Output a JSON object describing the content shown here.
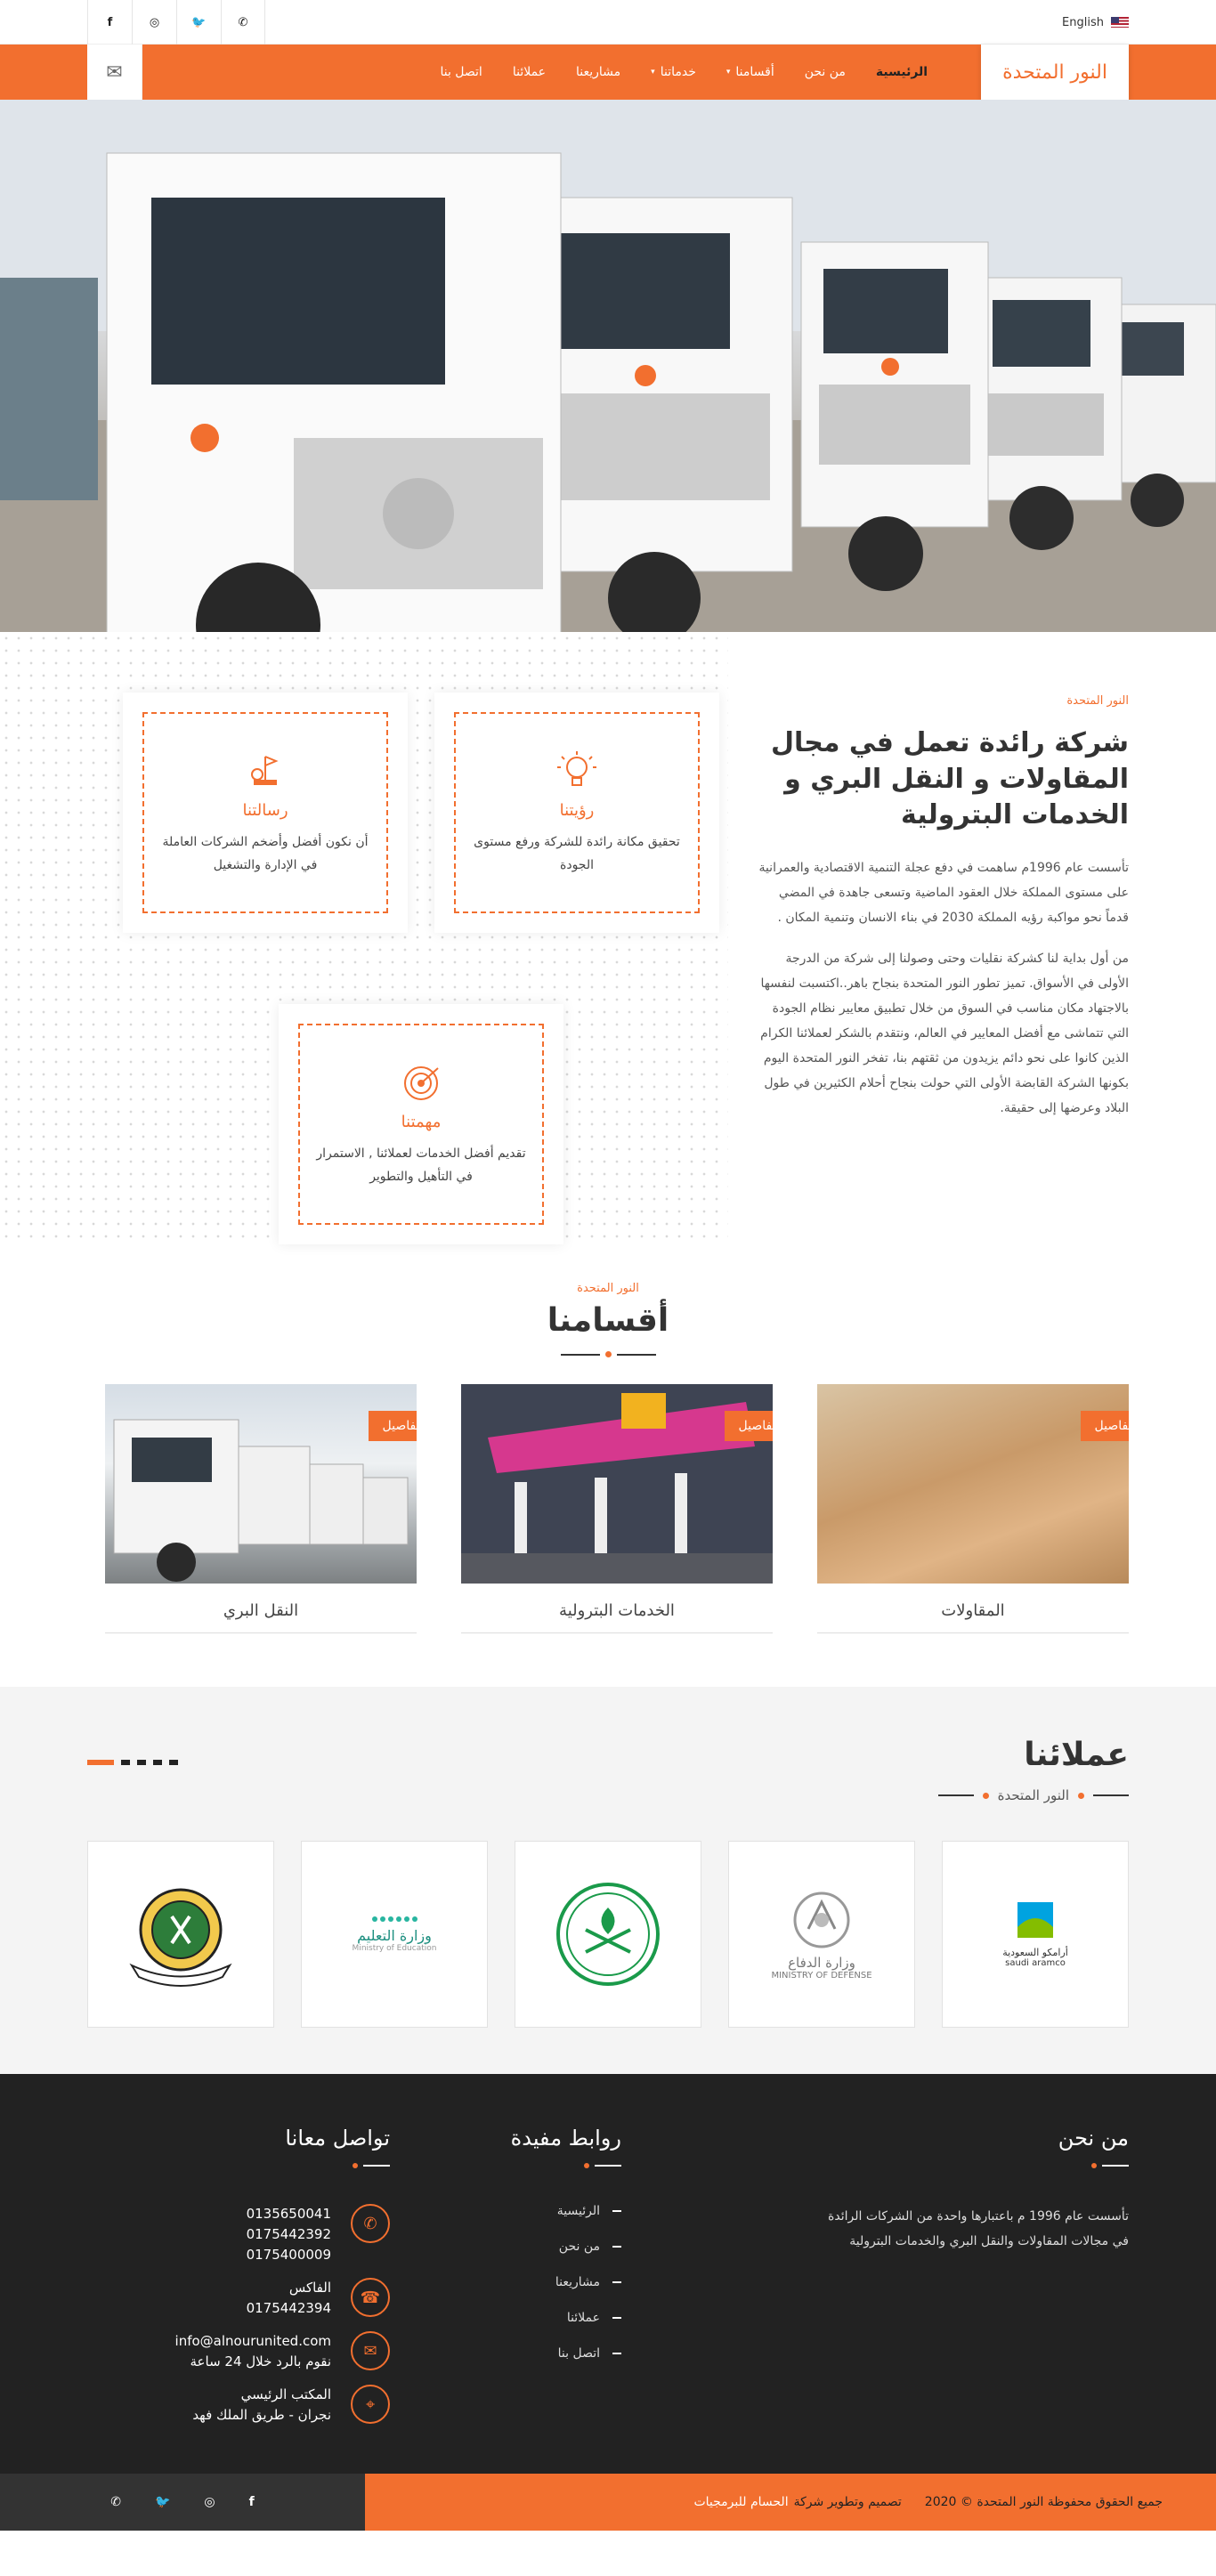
{
  "topbar": {
    "language": "English",
    "social": [
      {
        "icon": "whatsapp-icon",
        "glyph": "✆"
      },
      {
        "icon": "twitter-icon",
        "glyph": "🐦"
      },
      {
        "icon": "instagram-icon",
        "glyph": "◎"
      },
      {
        "icon": "facebook-icon",
        "glyph": "f"
      }
    ]
  },
  "nav": {
    "brand": "النور المتحدة",
    "items": [
      "الرئيسية",
      "من نحن",
      "أقسامنا",
      "خدماتنا",
      "مشاريعنا",
      "عملائنا",
      "اتصل بنا"
    ]
  },
  "about": {
    "kicker": "النور المتحدة",
    "title": "شركة رائدة تعمل في مجال المقاولات و النقل البري و الخدمات البترولية",
    "p1": "تأسست عام 1996م ساهمت في دفع عجلة التنمية الاقتصادية والعمرانية على مستوى المملكة خلال العقود الماضية وتسعى جاهدة في المضي قدماً نحو مواكبة رؤيه المملكة 2030 في بناء الانسان وتنمية المكان .",
    "p2": "من أول بداية لنا كشركة نقليات وحتى وصولنا إلى شركة من الدرجة الأولى في الأسواق. تميز تطور النور المتحدة بنجاح باهر..اكتسبت لنفسها بالاجتهاد مكان مناسب في السوق من خلال تطبيق معايير نظام الجودة التي تتماشى مع أفضل المعايير في العالم، ونتقدم بالشكر لعملائنا الكرام الذين كانوا على نحو دائم يزيدون من ثقتهم بنا، تفخر النور المتحدة اليوم بكونها الشركة القابضة الأولى التي حولت بنجاح أحلام الكثيرين في طول البلاد وعرضها إلى حقيقة.",
    "cards": [
      {
        "title": "رؤيتنا",
        "text": "تحقيق مكانة رائدة للشركة ورفع مستوى الجودة",
        "icon": "lightbulb-icon"
      },
      {
        "title": "رسالتنا",
        "text": "أن نكون أفضل وأضخم الشركات العاملة في الإدارة والتشغيل",
        "icon": "flag-icon"
      },
      {
        "title": "مهمتنا",
        "text": "تقديم أفضل الخدمات لعملائنا , الاستمرار في التأهيل والتطوير",
        "icon": "target-icon"
      }
    ]
  },
  "sections": {
    "kicker": "النور المتحدة",
    "title": "أقسامنا",
    "items": [
      {
        "name": "المقاولات",
        "badge": "التفاصيل"
      },
      {
        "name": "الخدمات البترولية",
        "badge": "التفاصيل"
      },
      {
        "name": "النقل البري",
        "badge": "التفاصيل"
      }
    ]
  },
  "clients": {
    "title": "عملائنا",
    "subtitle": "النور المتحدة",
    "logos": [
      {
        "name": "أرامكو السعودية",
        "sub": "saudi aramco"
      },
      {
        "name": "وزارة الدفاع",
        "sub": "MINISTRY OF DEFENSE"
      },
      {
        "name": "emblem",
        "sub": ""
      },
      {
        "name": "وزارة التعليم",
        "sub": "Ministry of Education"
      },
      {
        "name": "وزارة الحرس الوطني",
        "sub": ""
      }
    ]
  },
  "footer": {
    "about_title": "من نحن",
    "about_text": "تأسست عام 1996 م باعتبارها واحدة من الشركات الرائدة في مجالات المقاولات والنقل البري والخدمات البترولية",
    "links_title": "روابط مفيدة",
    "links": [
      "الرئيسية",
      "من نحن",
      "مشاريعنا",
      "عملائنا",
      "اتصل بنا"
    ],
    "contact_title": "تواصل معانا",
    "phones": [
      "0135650041",
      "0175442392",
      "0175400009"
    ],
    "fax_label": "الفاكس",
    "fax": "0175442394",
    "email": "info@alnourunited.com",
    "email_note": "نقوم بالرد خلال 24 ساعة",
    "address_label": "المكتب الرئيسي",
    "address": "نجران - طريق الملك فهد"
  },
  "bottombar": {
    "copyright": "جميع الحقوق محفوظة النور المتحدة © 2020",
    "design": "تصميم وتطوير شركة",
    "designer": "الحسام للبرمجيات"
  },
  "colors": {
    "accent": "#f26f2f",
    "dark": "#222222"
  }
}
